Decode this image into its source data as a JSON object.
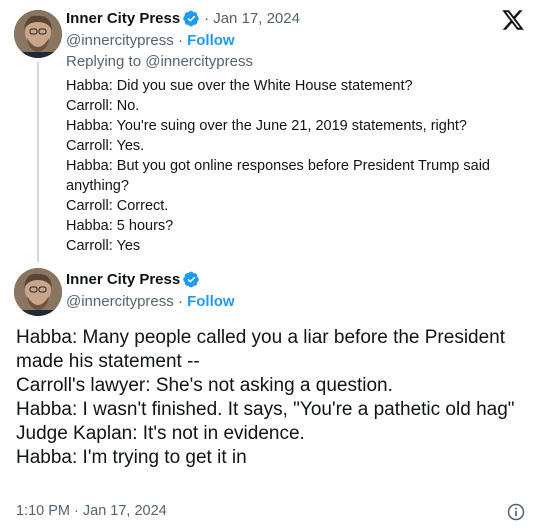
{
  "quoted": {
    "name": "Inner City Press",
    "date": "Jan 17, 2024",
    "handle": "@innercitypress",
    "follow_label": "Follow",
    "reply_to": "Replying to @innercitypress",
    "lines": [
      "Habba: Did you sue over the White House statement?",
      "Carroll: No.",
      "Habba: You're suing over the June 21, 2019 statements, right?",
      "Carroll: Yes.",
      "Habba: But you got online responses before President Trump said anything?",
      "Carroll: Correct.",
      "Habba: 5 hours?",
      "Carroll: Yes"
    ]
  },
  "main": {
    "name": "Inner City Press",
    "handle": "@innercitypress",
    "follow_label": "Follow",
    "lines": [
      "Habba: Many people called you a liar before the President made his statement --",
      "Carroll's lawyer: She's not asking a question.",
      "Habba: I wasn't finished. It says, \"You're a pathetic old hag\"",
      "Judge Kaplan: It's not in evidence.",
      "Habba: I'm trying to get it in"
    ],
    "timestamp": "1:10 PM · Jan 17, 2024"
  },
  "colors": {
    "accent": "#1d9bf0",
    "secondary_text": "#536471",
    "primary_text": "#0f1419"
  },
  "icons": [
    "verified-badge-icon",
    "x-logo-icon",
    "info-icon"
  ]
}
